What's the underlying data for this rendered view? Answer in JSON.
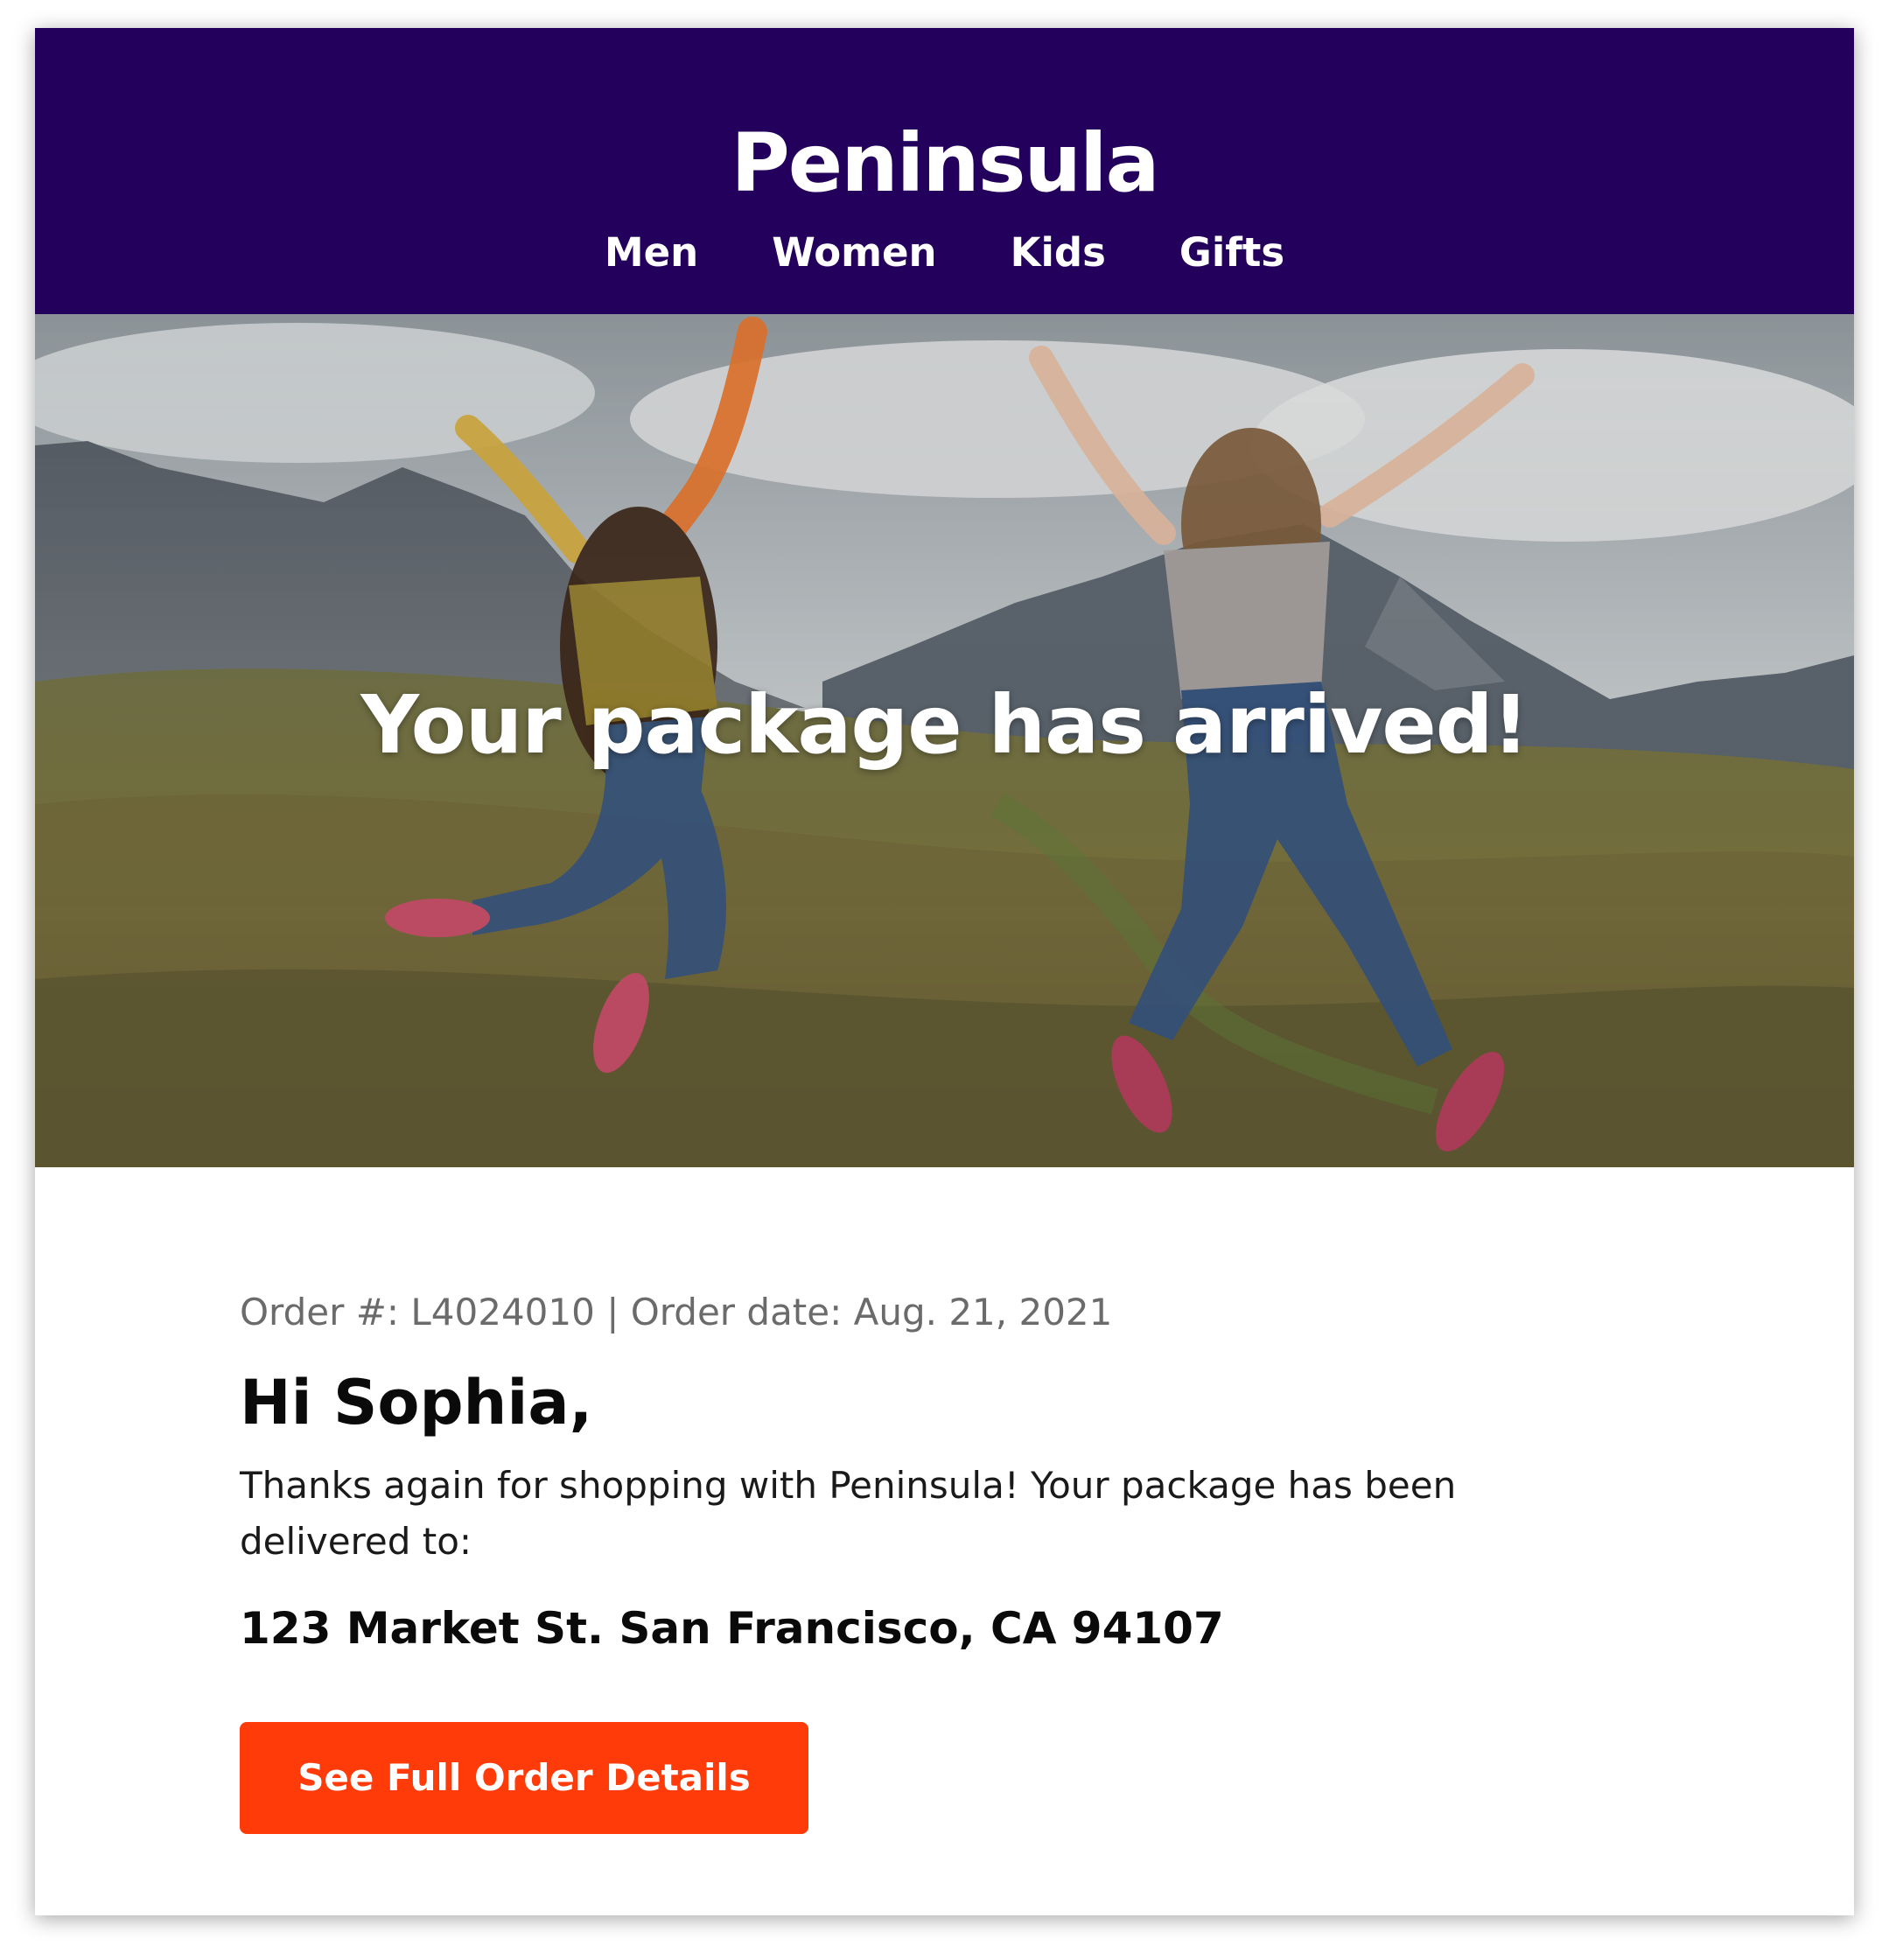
{
  "brand": {
    "name": "Peninsula"
  },
  "nav": {
    "items": [
      {
        "label": "Men"
      },
      {
        "label": "Women"
      },
      {
        "label": "Kids"
      },
      {
        "label": "Gifts"
      }
    ]
  },
  "hero": {
    "title": "Your package has arrived!"
  },
  "order": {
    "meta": "Order #: L4024010 | Order date: Aug. 21, 2021"
  },
  "greeting": "Hi Sophia,",
  "message": "Thanks again for shopping with Peninsula! Your package has been delivered to:",
  "address": "123 Market St. San Francisco, CA 94107",
  "cta": {
    "label": "See Full Order Details"
  },
  "colors": {
    "header_bg": "#23005b",
    "cta_bg": "#ff3b0a",
    "card_bg": "#ffffff"
  }
}
